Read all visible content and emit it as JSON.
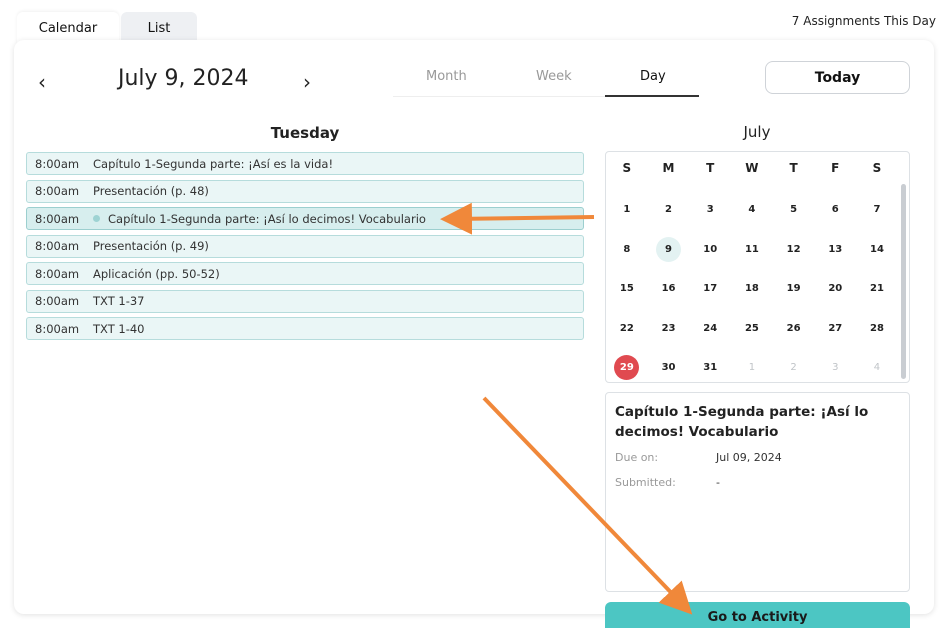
{
  "tabs": {
    "calendar": "Calendar",
    "list": "List"
  },
  "assignments_count": "7 Assignments This Day",
  "header": {
    "prev": "‹",
    "next": "›",
    "date": "July 9, 2024",
    "views": {
      "month": "Month",
      "week": "Week",
      "day": "Day"
    },
    "active_view": "Day",
    "today": "Today"
  },
  "day": {
    "heading": "Tuesday",
    "events": [
      {
        "time": "8:00am",
        "title": "Capítulo 1-Segunda parte: ¡Así es la vida!"
      },
      {
        "time": "8:00am",
        "title": "Presentación (p. 48)"
      },
      {
        "time": "8:00am",
        "title": "Capítulo 1-Segunda parte: ¡Así lo decimos! Vocabulario",
        "selected": true
      },
      {
        "time": "8:00am",
        "title": "Presentación (p. 49)"
      },
      {
        "time": "8:00am",
        "title": "Aplicación (pp. 50-52)"
      },
      {
        "time": "8:00am",
        "title": "TXT 1-37"
      },
      {
        "time": "8:00am",
        "title": "TXT 1-40"
      }
    ]
  },
  "calendar": {
    "month": "July",
    "weekdays": [
      "S",
      "M",
      "T",
      "W",
      "T",
      "F",
      "S"
    ],
    "rows": [
      [
        "1",
        "2",
        "3",
        "4",
        "5",
        "6",
        "7"
      ],
      [
        "8",
        "9",
        "10",
        "11",
        "12",
        "13",
        "14"
      ],
      [
        "15",
        "16",
        "17",
        "18",
        "19",
        "20",
        "21"
      ],
      [
        "22",
        "23",
        "24",
        "25",
        "26",
        "27",
        "28"
      ],
      [
        "29",
        "30",
        "31",
        "1",
        "2",
        "3",
        "4"
      ]
    ],
    "selected_day": "9",
    "today_day": "29",
    "muted_from_last_row_index": 3
  },
  "detail": {
    "title": "Capítulo 1-Segunda parte: ¡Así lo decimos! Vocabulario",
    "due_label": "Due on:",
    "due_value": "Jul 09, 2024",
    "submitted_label": "Submitted:",
    "submitted_value": "-"
  },
  "go_button": "Go to Activity",
  "colors": {
    "accent": "#4cc6c3",
    "today": "#e04a50",
    "event_bg": "#eaf6f6",
    "arrow": "#f0883a"
  }
}
